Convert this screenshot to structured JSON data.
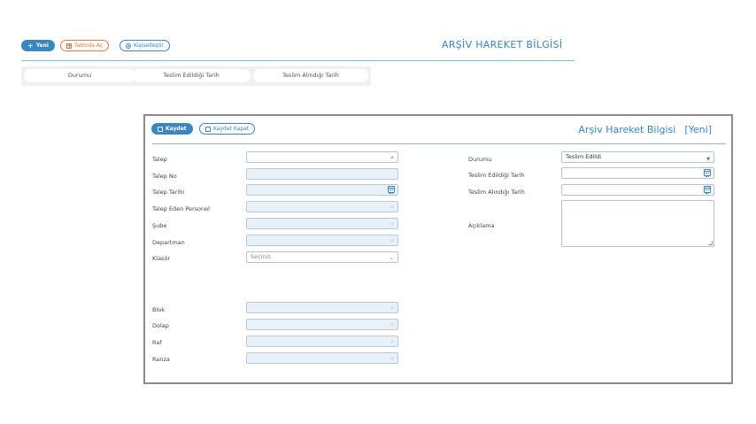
{
  "toolbar": {
    "new_label": "Yeni",
    "new_icon": "plus-icon",
    "table_label": "Tabloda Aç",
    "table_icon": "table-icon",
    "customize_label": "Kişiselleştir",
    "customize_icon": "gear-icon"
  },
  "page_title": "ARŞİV HAREKET BİLGİSİ",
  "filters": [
    "Durumu",
    "Teslim Edildiği Tarih",
    "Teslim Alındığı Tarih"
  ],
  "modal": {
    "save_label": "Kaydet",
    "save_close_label": "Kaydet Kapat",
    "title": "Arşiv Hareket Bilgisi",
    "title_tag": "[Yeni]",
    "left_fields": {
      "talep": "Talep",
      "talep_no": "Talep No",
      "talep_tarihi": "Talep Tarihi",
      "talep_eden_personel": "Talep Eden Personel",
      "sube": "Şube",
      "departman": "Departman",
      "klasor": "Klasör",
      "klasor_value": "Seçiniz",
      "blok": "Blok",
      "dolap": "Dolap",
      "raf": "Raf",
      "ranza": "Ranza"
    },
    "right_fields": {
      "durumu": "Durumu",
      "durumu_value": "Teslim Edildi",
      "teslim_edildigi_tarih": "Teslim Edildiği Tarih",
      "teslim_alindigi_tarih": "Teslim Alındığı Tarih",
      "aciklama": "Açıklama"
    }
  },
  "colors": {
    "accent": "#3a86c0",
    "orange": "#e07b39",
    "field_blue": "#e8f1f8"
  }
}
